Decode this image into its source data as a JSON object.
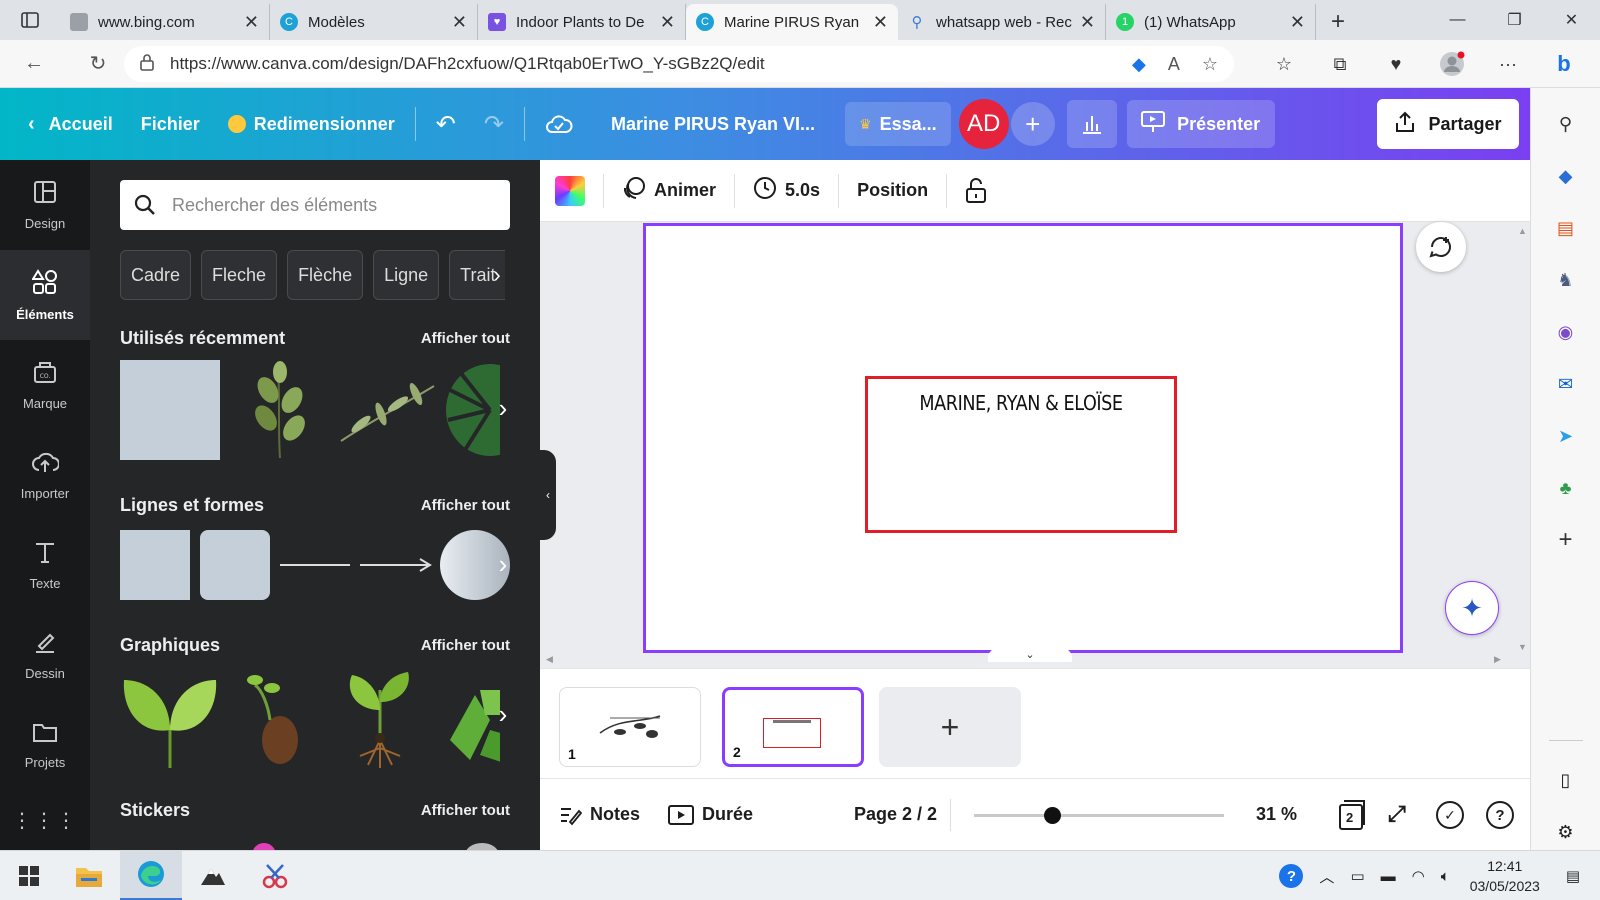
{
  "browser": {
    "tabs": [
      {
        "title": "www.bing.com",
        "icon": "page-icon",
        "color": "#9aa0a6"
      },
      {
        "title": "Modèles",
        "icon": "canva-icon",
        "color": "#1da1d6"
      },
      {
        "title": "Indoor Plants to De",
        "icon": "bookmark-icon",
        "color": "#7a52e3"
      },
      {
        "title": "Marine PIRUS Ryan",
        "icon": "canva-icon",
        "color": "#1da1d6"
      },
      {
        "title": "whatsapp web - Rec",
        "icon": "search-icon",
        "color": "#3b7bd6"
      },
      {
        "title": "(1) WhatsApp",
        "icon": "whatsapp-icon",
        "color": "#25d366"
      }
    ],
    "url": "https://www.canva.com/design/DAFh2cxfuow/Q1Rtqab0ErTwO_Y-sGBz2Q/edit"
  },
  "header": {
    "home": "Accueil",
    "file": "Fichier",
    "resize": "Redimensionner",
    "title": "Marine PIRUS Ryan VI...",
    "trial": "Essa...",
    "avatar": "AD",
    "present": "Présenter",
    "share": "Partager"
  },
  "rail": [
    {
      "label": "Design",
      "icon": "layout-icon"
    },
    {
      "label": "Éléments",
      "icon": "shapes-icon",
      "active": true
    },
    {
      "label": "Marque",
      "icon": "brand-icon"
    },
    {
      "label": "Importer",
      "icon": "upload-icon"
    },
    {
      "label": "Texte",
      "icon": "text-icon"
    },
    {
      "label": "Dessin",
      "icon": "draw-icon"
    },
    {
      "label": "Projets",
      "icon": "folder-icon"
    }
  ],
  "panel": {
    "search_placeholder": "Rechercher des éléments",
    "chips": [
      "Cadre",
      "Fleche",
      "Flèche",
      "Ligne",
      "Trait"
    ],
    "sections": {
      "recent": "Utilisés récemment",
      "lines": "Lignes et formes",
      "graphics": "Graphiques",
      "stickers": "Stickers"
    },
    "see_all": "Afficher tout"
  },
  "toolbar": {
    "animate": "Animer",
    "duration": "5.0s",
    "position": "Position"
  },
  "canvas": {
    "text": "MARINE, RYAN & ELOÏSE"
  },
  "pages": {
    "thumb1": "1",
    "thumb2": "2",
    "counter": "Page 2 / 2"
  },
  "footer": {
    "notes": "Notes",
    "duration": "Durée",
    "zoom": "31 %",
    "zoom_level": 0.31,
    "grid_badge": "2"
  },
  "taskbar": {
    "time": "12:41",
    "date": "03/05/2023"
  },
  "colors": {
    "accent": "#8b3dff",
    "frame": "#e01e27",
    "avatar": "#e6233d"
  }
}
